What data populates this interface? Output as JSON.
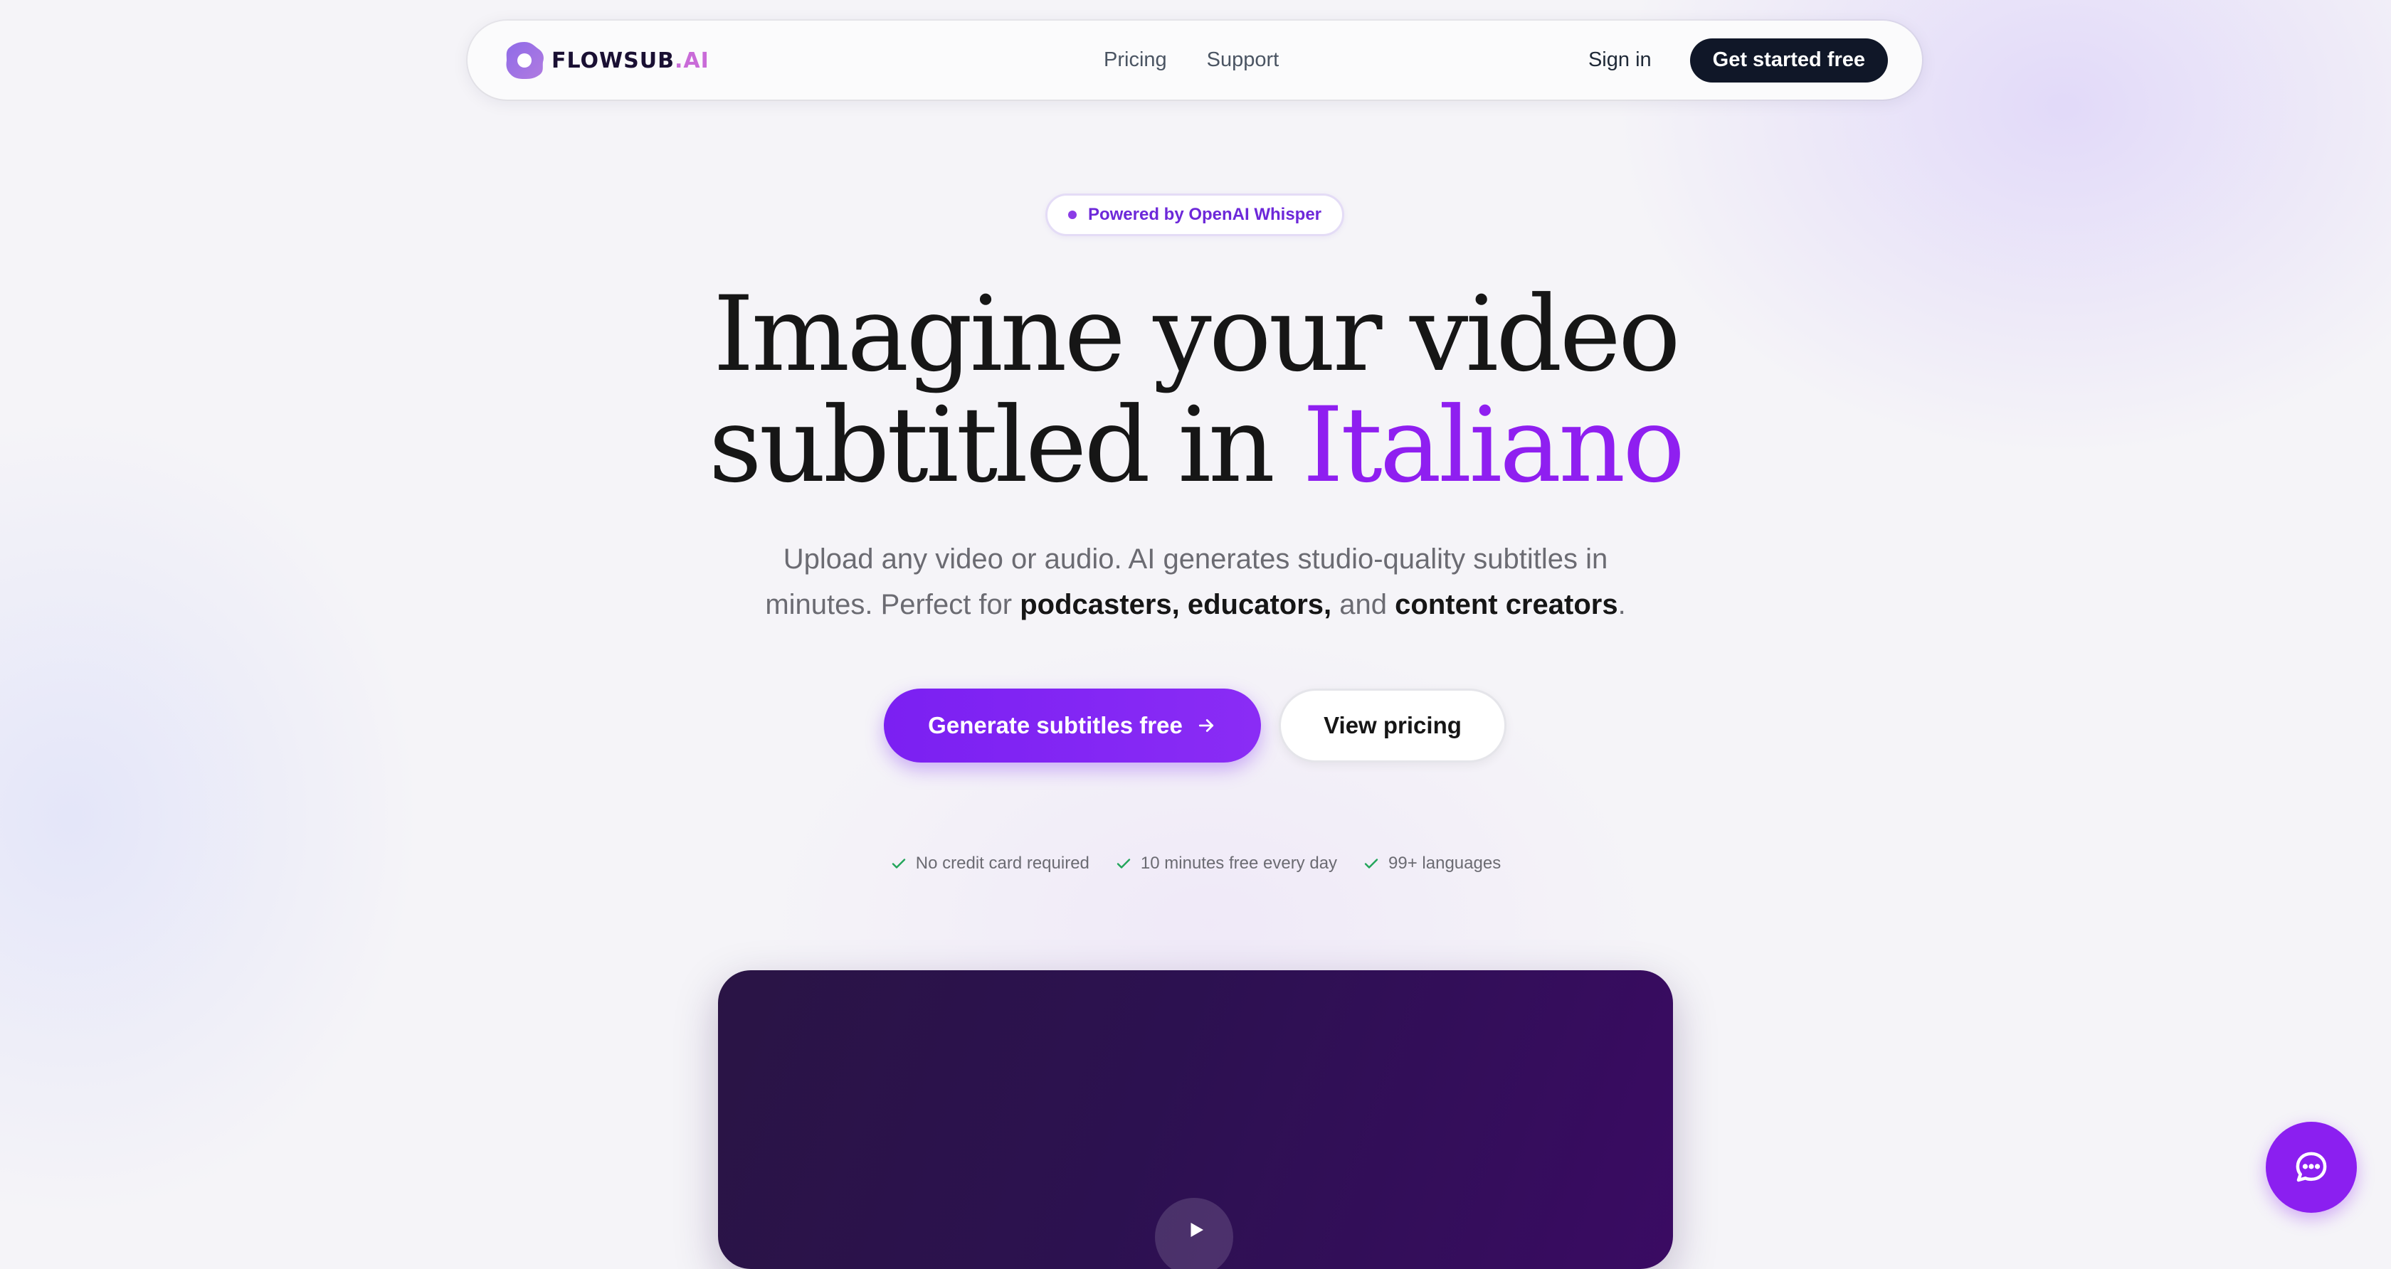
{
  "nav": {
    "logo_main": "FLOWSUB",
    "logo_suffix": ".AI",
    "links": [
      "Pricing",
      "Support"
    ],
    "sign_in": "Sign in",
    "cta": "Get started free"
  },
  "hero": {
    "badge": "Powered by OpenAI Whisper",
    "headline_line1": "Imagine your video",
    "headline_line2_prefix": "subtitled in ",
    "headline_accent": "Italiano",
    "sub_line1": "Upload any video or audio. AI generates studio-quality subtitles in",
    "sub_line2_prefix": "minutes. Perfect for ",
    "sub_bold1": "podcasters, educators,",
    "sub_and": " and ",
    "sub_bold2": "content creators",
    "sub_end": ".",
    "primary_button": "Generate subtitles free",
    "secondary_button": "View pricing",
    "checks": [
      "No credit card required",
      "10 minutes free every day",
      "99+ languages"
    ]
  },
  "icons": {
    "primary_arrow": "arrow-right-icon",
    "check": "check-icon",
    "play": "play-icon",
    "chat": "chat-bubble-icon"
  },
  "colors": {
    "accent": "#8f1ff0",
    "dark": "#101728",
    "check_green": "#22a55a"
  }
}
